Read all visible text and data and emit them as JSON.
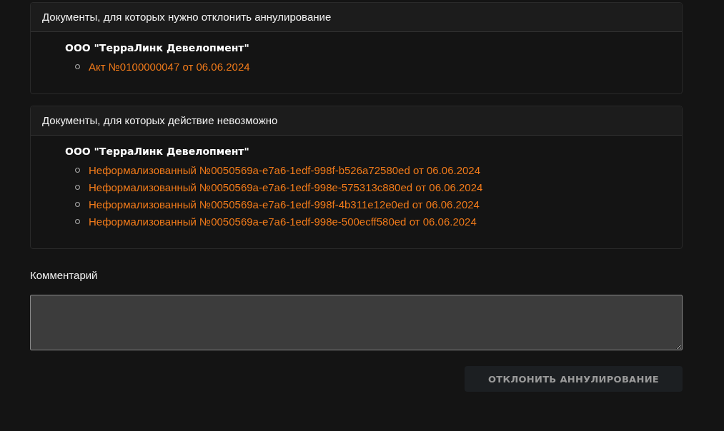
{
  "panels": [
    {
      "title": "Документы, для которых нужно отклонить аннулирование",
      "groups": [
        {
          "company": "ООО \"ТерраЛинк Девелопмент\"",
          "documents": [
            "Акт №0100000047 от 06.06.2024"
          ]
        }
      ]
    },
    {
      "title": "Документы, для которых действие невозможно",
      "groups": [
        {
          "company": "ООО \"ТерраЛинк Девелопмент\"",
          "documents": [
            "Неформализованный №0050569a-e7a6-1edf-998f-b526a72580ed от 06.06.2024",
            "Неформализованный №0050569a-e7a6-1edf-998e-575313c880ed от 06.06.2024",
            "Неформализованный №0050569a-e7a6-1edf-998f-4b311e12e0ed от 06.06.2024",
            "Неформализованный №0050569a-e7a6-1edf-998e-500ecff580ed от 06.06.2024"
          ]
        }
      ]
    }
  ],
  "comment": {
    "label": "Комментарий"
  },
  "submit": {
    "label": "ОТКЛОНИТЬ АННУЛИРОВАНИЕ",
    "disabled": true
  }
}
